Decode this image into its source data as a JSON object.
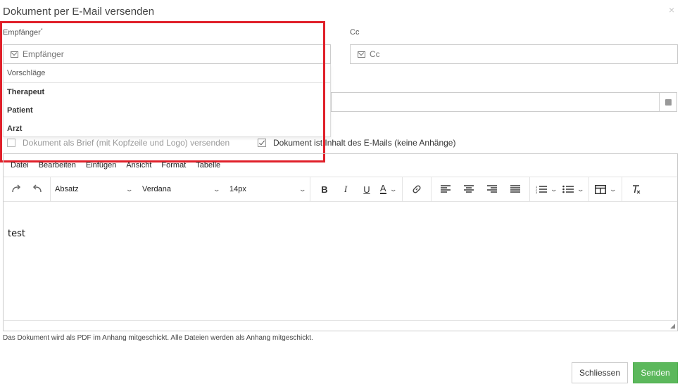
{
  "dialog": {
    "title": "Dokument per E-Mail versenden",
    "close_icon": "×"
  },
  "recipient": {
    "label": "Empfänger",
    "required_mark": "*",
    "placeholder": "Empfänger",
    "suggestions_header": "Vorschläge",
    "suggestions": [
      "Therapeut",
      "Patient",
      "Arzt"
    ]
  },
  "cc": {
    "label": "Cc",
    "placeholder": "Cc"
  },
  "options": {
    "letter_label": "Dokument als Brief (mit Kopfzeile und Logo) versenden",
    "letter_checked": false,
    "content_label": "Dokument ist Inhalt des E-Mails (keine Anhänge)",
    "content_checked": true
  },
  "editor": {
    "menu": [
      "Datei",
      "Bearbeiten",
      "Einfügen",
      "Ansicht",
      "Format",
      "Tabelle"
    ],
    "block_format": "Absatz",
    "font_family": "Verdana",
    "font_size": "14px",
    "body_text": "test"
  },
  "info_text": "Das Dokument wird als PDF im Anhang mitgeschickt. Alle Dateien werden als Anhang mitgeschickt.",
  "buttons": {
    "close_label": "Schliessen",
    "send_label": "Senden"
  },
  "colors": {
    "send_button": "#5cb85c",
    "highlight_box": "#e0202a"
  }
}
